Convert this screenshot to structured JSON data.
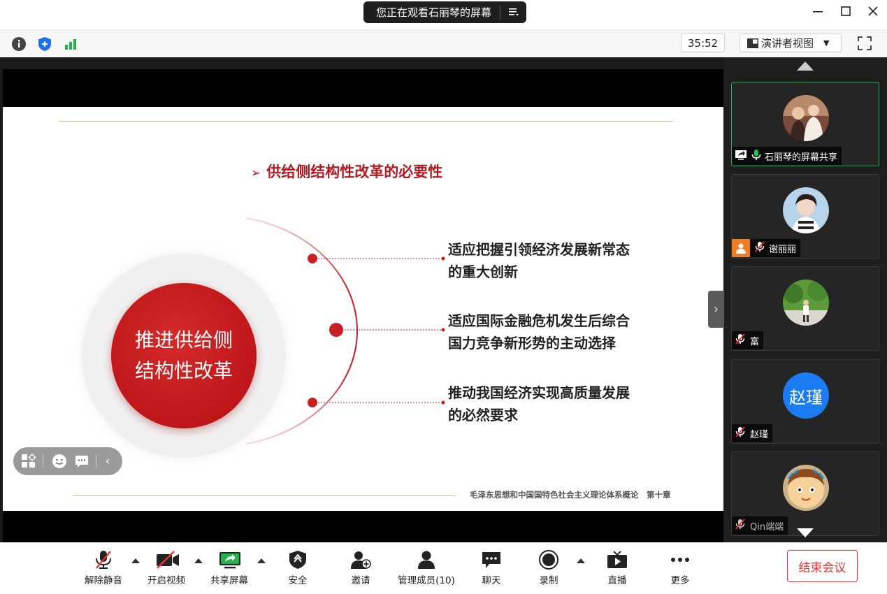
{
  "window": {
    "sharing_banner": "您正在观看石丽琴的屏幕",
    "menu_icon": "list-menu-icon",
    "controls": [
      "minimize-icon",
      "maximize-icon",
      "close-icon"
    ]
  },
  "toolbar": {
    "timer": "35:52",
    "view_mode": "演讲者视图",
    "icons": [
      "info-icon",
      "security-shield-icon",
      "signal-icon",
      "fullscreen-icon"
    ]
  },
  "slide": {
    "heading_marker": "➢",
    "heading": "供给侧结构性改革的必要性",
    "center_line1": "推进供给侧",
    "center_line2": "结构性改革",
    "items": [
      {
        "line1": "适应把握引领经济发展新常态",
        "line2": "的重大创新"
      },
      {
        "line1": "适应国际金融危机发生后综合",
        "line2": "国力竞争新形势的主动选择"
      },
      {
        "line1": "推动我国经济实现高质量发展",
        "line2": "的必然要求"
      }
    ],
    "footer": "毛泽东思想和中国国特色社会主义理论体系概论　第十章",
    "accent_color": "#b01a20"
  },
  "participants": [
    {
      "name": "石丽琴的屏幕共享",
      "avatar": "photo",
      "sharing": true,
      "mic": "on"
    },
    {
      "name": "谢丽丽",
      "avatar": "photo",
      "mic": "muted",
      "role_icon": "host-icon"
    },
    {
      "name": "富",
      "avatar": "photo",
      "mic": "muted"
    },
    {
      "name": "赵瑾",
      "avatar": "initials",
      "avatar_text": "赵瑾",
      "avatar_color": "#1a7cf0",
      "mic": "muted"
    },
    {
      "name": "Qin端端",
      "avatar": "cartoon",
      "mic": "muted"
    }
  ],
  "bottombar": {
    "buttons": [
      {
        "label": "解除静音",
        "icon": "mic-muted-icon"
      },
      {
        "label": "开启视频",
        "icon": "camera-off-icon"
      },
      {
        "label": "共享屏幕",
        "icon": "share-screen-icon"
      },
      {
        "label": "安全",
        "icon": "security-shield-icon"
      },
      {
        "label": "邀请",
        "icon": "invite-user-icon"
      },
      {
        "label": "管理成员(10)",
        "icon": "members-icon"
      },
      {
        "label": "聊天",
        "icon": "chat-icon"
      },
      {
        "label": "录制",
        "icon": "record-icon"
      },
      {
        "label": "直播",
        "icon": "live-icon"
      },
      {
        "label": "更多",
        "icon": "more-icon"
      }
    ],
    "end_meeting": "结束会议"
  }
}
